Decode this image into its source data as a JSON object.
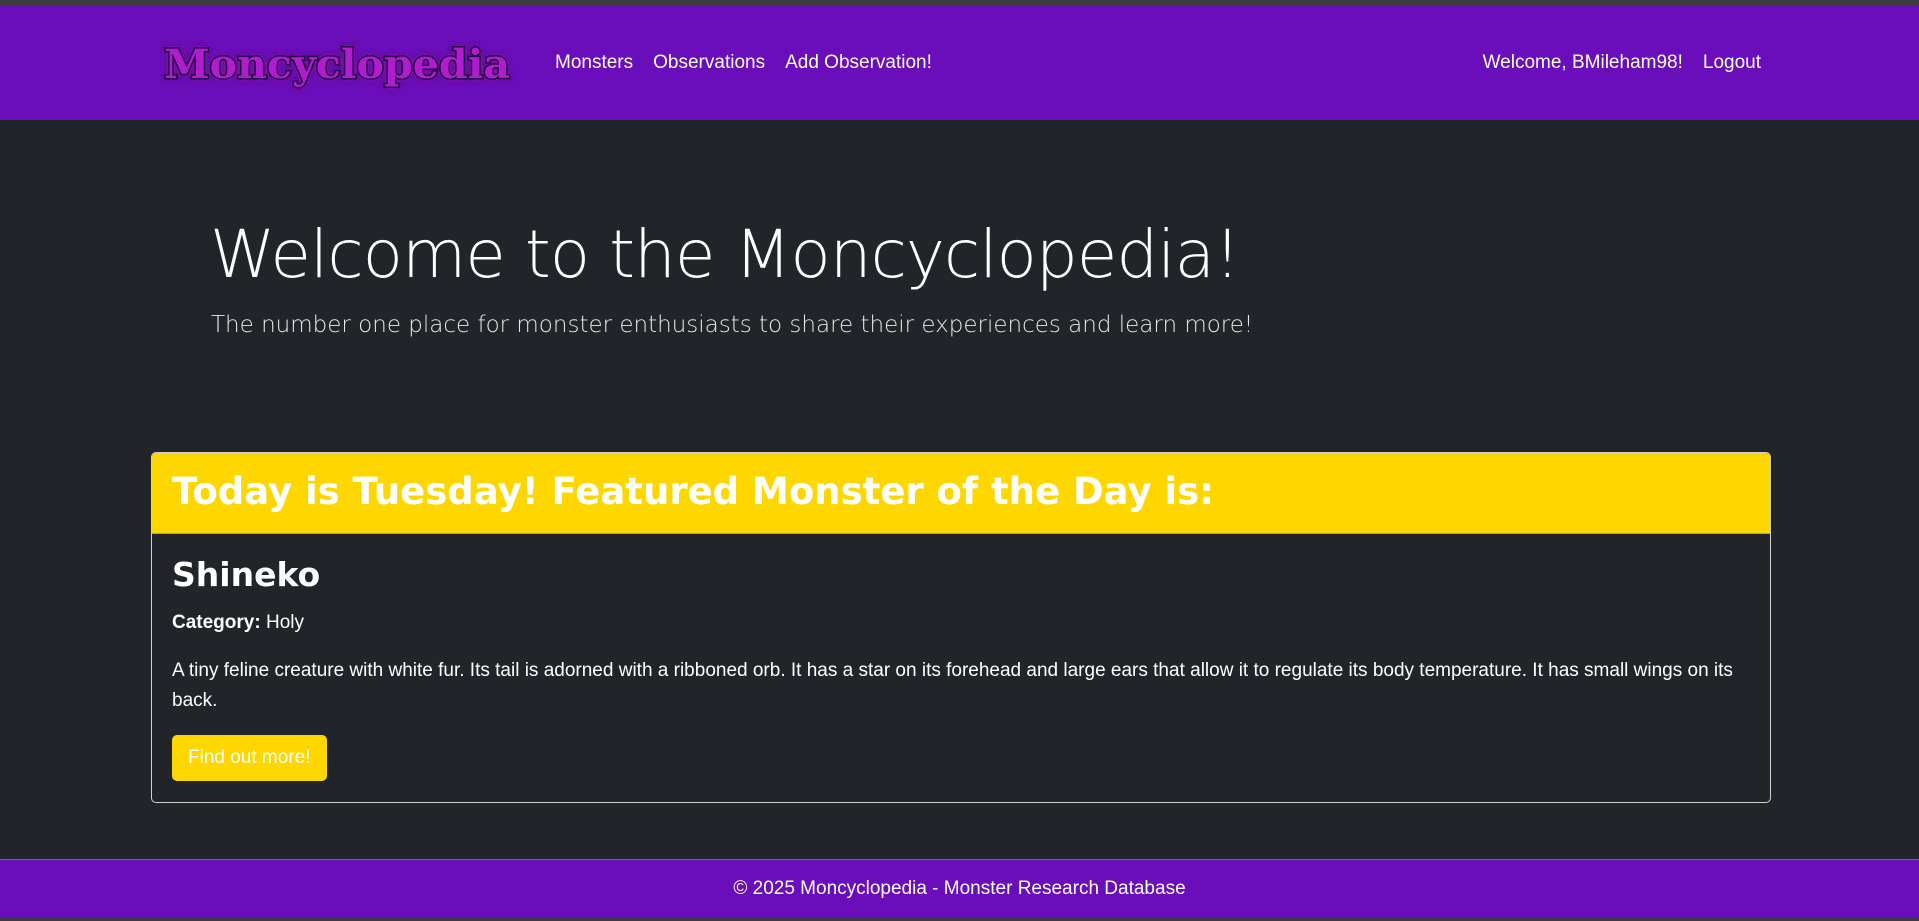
{
  "colors": {
    "navbar": "#6a0dba",
    "background": "#212529",
    "accent": "#ffd700",
    "text": "#ffffff"
  },
  "navbar": {
    "brand_text": "Moncyclopedia",
    "links": [
      {
        "label": "Monsters"
      },
      {
        "label": "Observations"
      },
      {
        "label": "Add Observation!"
      }
    ],
    "welcome": "Welcome, BMileham98!",
    "logout": "Logout"
  },
  "hero": {
    "title": "Welcome to the Moncyclopedia!",
    "subtitle": "The number one place for monster enthusiasts to share their experiences and learn more!"
  },
  "featured": {
    "header": "Today is Tuesday! Featured Monster of the Day is:",
    "name": "Shineko",
    "category_label": "Category:",
    "category_value": "Holy",
    "description": "A tiny feline creature with white fur. Its tail is adorned with a ribboned orb. It has a star on its forehead and large ears that allow it to regulate its body temperature. It has small wings on its back.",
    "button": "Find out more!"
  },
  "footer": {
    "text": "© 2025 Moncyclopedia - Monster Research Database"
  }
}
